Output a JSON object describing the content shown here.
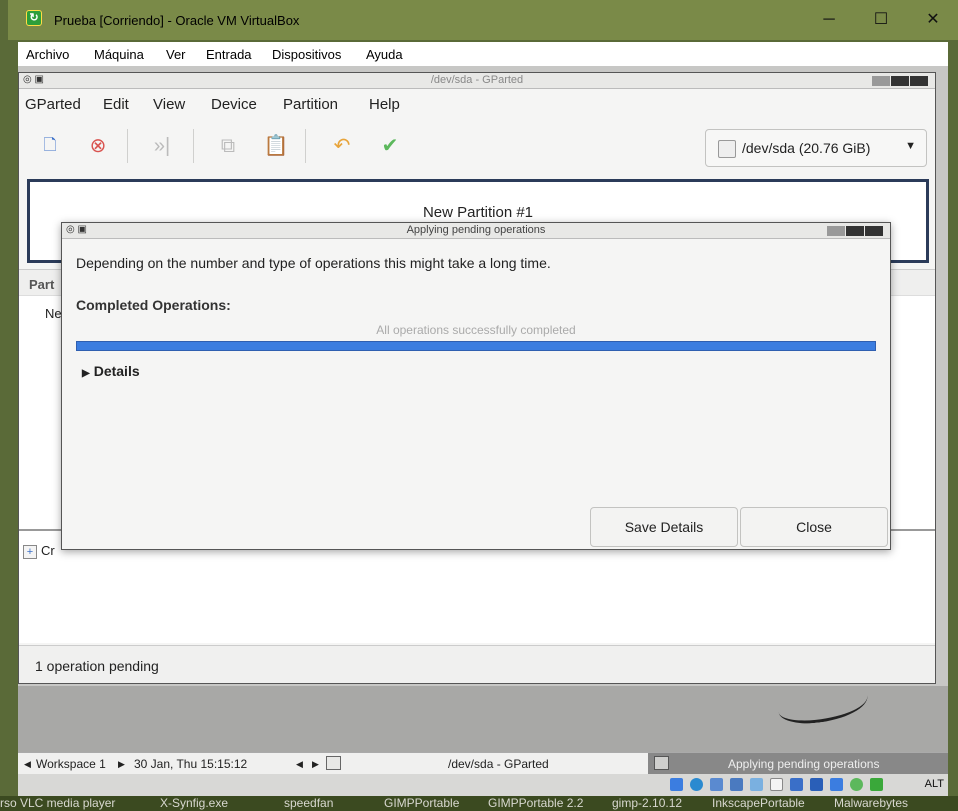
{
  "vbox": {
    "title": "Prueba [Corriendo] - Oracle VM VirtualBox",
    "menu": [
      "Archivo",
      "Máquina",
      "Ver",
      "Entrada",
      "Dispositivos",
      "Ayuda"
    ],
    "host_key": "ALT"
  },
  "gparted": {
    "title": "/dev/sda - GParted",
    "menu": [
      "GParted",
      "Edit",
      "View",
      "Device",
      "Partition",
      "Help"
    ],
    "device": "/dev/sda (20.76 GiB)",
    "partition_graphic_label": "New Partition #1",
    "list_header_partial": "Part",
    "list_row_partial": "Ne",
    "ops_item_partial": "Cr",
    "status": "1 operation pending"
  },
  "dialog": {
    "title": "Applying pending operations",
    "description": "Depending on the number and type of operations this might take a long time.",
    "completed_label": "Completed Operations:",
    "progress_text": "All operations successfully completed",
    "progress_fraction": 1.0,
    "details_label": "Details",
    "save_button": "Save Details",
    "close_button": "Close"
  },
  "guest_taskbar": {
    "workspace": "Workspace 1",
    "datetime": "30 Jan, Thu 15:15:12",
    "task1": "/dev/sda - GParted",
    "task2": "Applying pending operations"
  },
  "host_taskbar": {
    "items": [
      "rso VLC media player",
      "X-Synfig.exe",
      "speedfan",
      "GIMPPortable",
      "GIMPPortable 2.2",
      "gimp-2.10.12",
      "InkscapePortable",
      "Malwarebytes"
    ]
  }
}
